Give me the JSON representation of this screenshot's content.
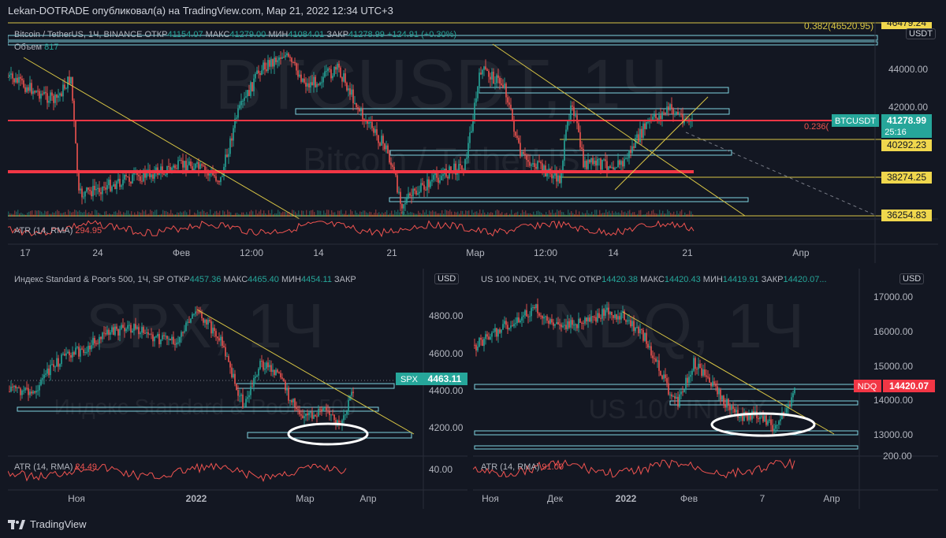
{
  "topbar": {
    "text": "Lekan-DOTRADE опубликовал(а) на TradingView.com, Мар 21, 2022 12:34 UTC+3"
  },
  "footer": {
    "brand": "TradingView",
    "logo_icon": "tradingview-logo-icon"
  },
  "colors": {
    "bg": "#131722",
    "up": "#26a69a",
    "down": "#ef5350",
    "cyan": "#7fd3e0",
    "yellow": "#d8c545",
    "red_line": "#f23645",
    "white": "#ffffff"
  },
  "charts": [
    {
      "id": "btc",
      "watermark": "BTCUSDT, 1Ч",
      "watermark2": "Bitcoin / TetherUS",
      "header": {
        "name": "Bitcoin / TetherUS, 1Ч, BINANCE",
        "o_label": "ОТКР",
        "o": "41154.07",
        "h_label": "МАКС",
        "h": "41279.00",
        "l_label": "МИН",
        "l": "41084.01",
        "c_label": "ЗАКР",
        "c": "41278.99",
        "chg": "+124.91 (+0.30%)"
      },
      "volume_label": "Объем",
      "volume_value": "817",
      "atr_label": "ATR (14, RMA)",
      "atr_value": "294.95",
      "currency": "USDT",
      "price_ticks": [
        "44000.00",
        "42000.00"
      ],
      "x_ticks": [
        "17",
        "24",
        "Фев",
        "12:00",
        "14",
        "21",
        "Мар",
        "12:00",
        "14",
        "21",
        "Апр"
      ],
      "level_labels": [
        "46479.24",
        "40292.23",
        "38274.25",
        "36254.83"
      ],
      "fib_labels": [
        "0.382(46520.95)",
        "0.236("
      ],
      "price_tag": {
        "symbol": "BTCUSDT",
        "price": "41278.99",
        "countdown": "25:16"
      }
    },
    {
      "id": "spx",
      "watermark": "SPX, 1Ч",
      "watermark2": "Индекс Standard & Poor's 500",
      "header": {
        "name": "Индекс Standard & Poor's 500, 1Ч, SP",
        "o_label": "ОТКР",
        "o": "4457.36",
        "h_label": "МАКС",
        "h": "4465.40",
        "l_label": "МИН",
        "l": "4454.11",
        "c_label": "ЗАКР"
      },
      "atr_label": "ATR (14, RMA)",
      "atr_value": "24.49",
      "currency": "USD",
      "price_ticks": [
        "4800.00",
        "4600.00",
        "4400.00",
        "4200.00"
      ],
      "atr_tick": "40.00",
      "x_ticks": [
        "Ноя",
        "2022",
        "Мар",
        "Апр"
      ],
      "price_tag": {
        "symbol": "SPX",
        "price": "4463.11"
      }
    },
    {
      "id": "ndq",
      "watermark": "NDQ, 1Ч",
      "watermark2": "US 100 INDEX",
      "header": {
        "name": "US 100 INDEX, 1Ч, TVC",
        "o_label": "ОТКР",
        "o": "14420.38",
        "h_label": "МАКС",
        "h": "14420.43",
        "l_label": "МИН",
        "l": "14419.91",
        "c_label": "ЗАКР",
        "c": "14420.07..."
      },
      "atr_label": "ATR (14, RMA)",
      "atr_value": "91.00",
      "currency": "USD",
      "price_ticks": [
        "17000.00",
        "16000.00",
        "15000.00",
        "14000.00",
        "13000.00"
      ],
      "atr_tick": "200.00",
      "x_ticks": [
        "Ноя",
        "Дек",
        "2022",
        "Фев",
        "7",
        "Апр"
      ],
      "price_tag": {
        "symbol": "NDQ",
        "price": "14420.07"
      }
    }
  ]
}
